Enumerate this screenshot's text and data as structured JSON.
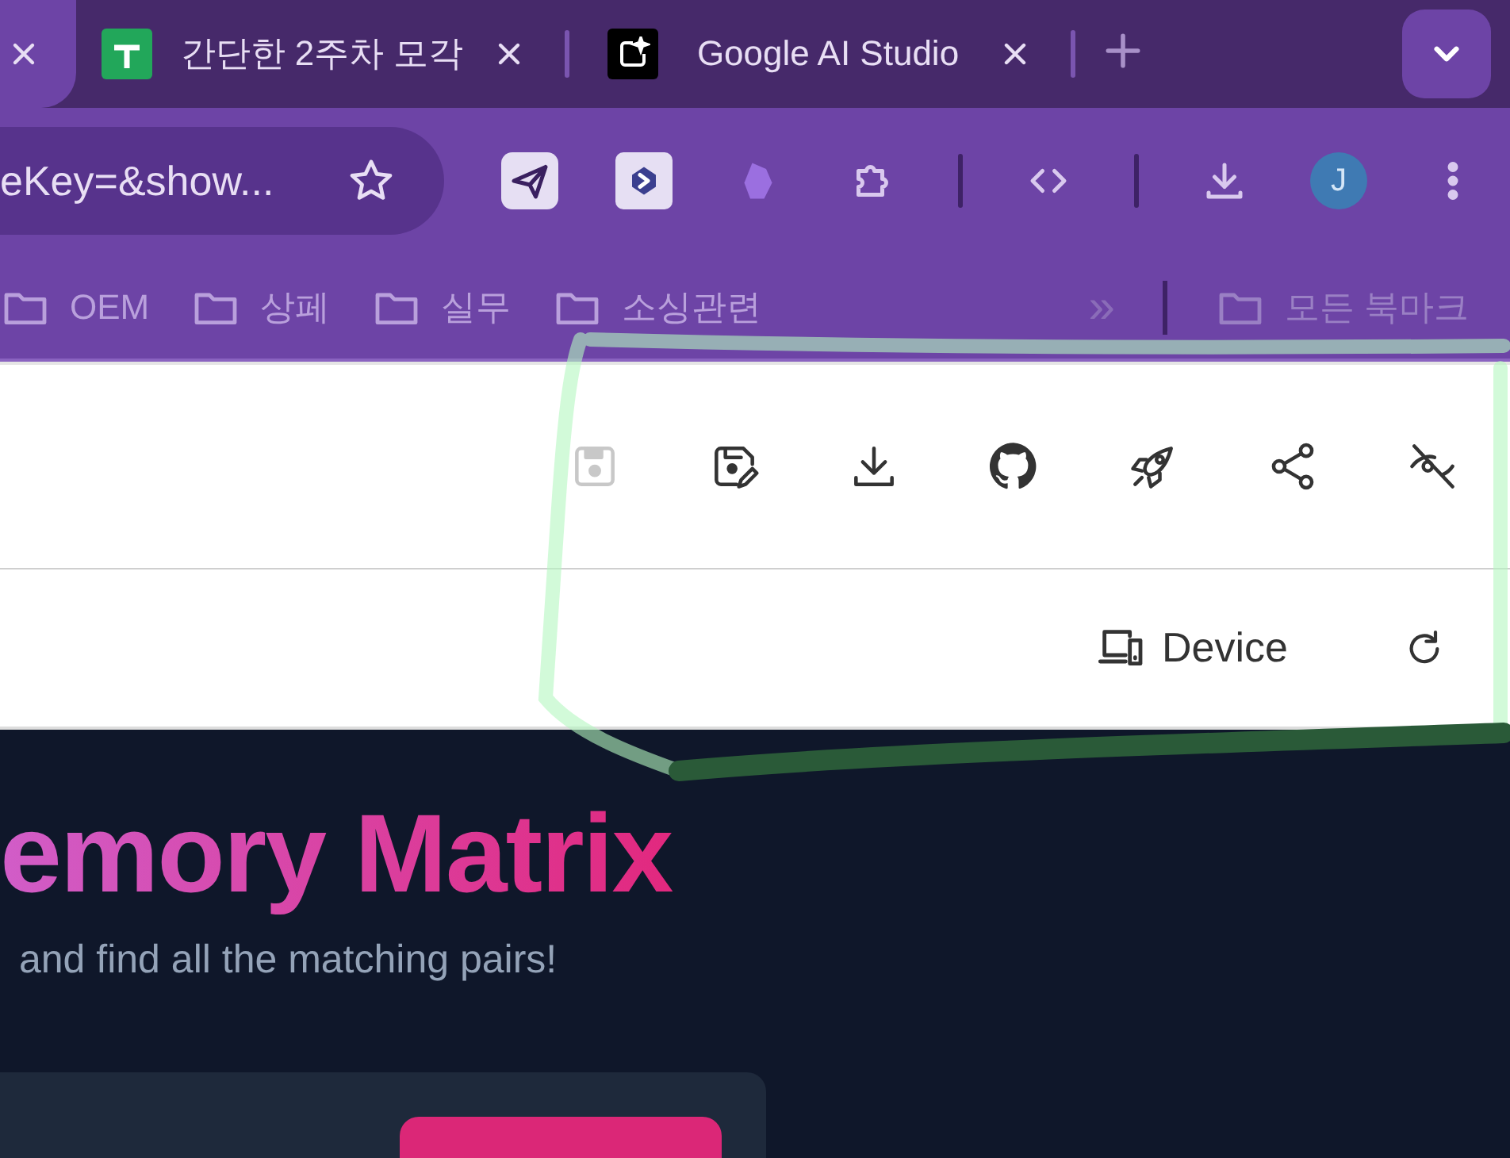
{
  "browser": {
    "tabs": [
      {
        "kind": "cut",
        "selected": true
      },
      {
        "kind": "sheet",
        "title": "간단한 2주차 모각",
        "selected": false
      },
      {
        "kind": "studio",
        "title": "Google AI Studio",
        "selected": false
      }
    ],
    "address": "eKey=&show...",
    "extensions": [
      {
        "kind": "plane"
      },
      {
        "kind": "graph"
      },
      {
        "kind": "gem"
      },
      {
        "kind": "puzzle"
      },
      {
        "kind": "divider"
      },
      {
        "kind": "code"
      },
      {
        "kind": "divider"
      },
      {
        "kind": "download"
      },
      {
        "kind": "avatar",
        "letter": "J"
      },
      {
        "kind": "menu"
      }
    ],
    "bookmarks": [
      {
        "label": "OEM"
      },
      {
        "label": "상페"
      },
      {
        "label": "실무"
      },
      {
        "label": "소싱관련"
      }
    ],
    "overflow": "»",
    "all_bookmarks": "모든 북마크"
  },
  "app_toolbar": {
    "actions": [
      {
        "kind": "save",
        "disabled": true
      },
      {
        "kind": "save-edit",
        "disabled": false
      },
      {
        "kind": "download",
        "disabled": false
      },
      {
        "kind": "github",
        "disabled": false
      },
      {
        "kind": "rocket",
        "disabled": false
      },
      {
        "kind": "share",
        "disabled": false
      },
      {
        "kind": "eye-off",
        "disabled": false
      }
    ],
    "device": "Device"
  },
  "page": {
    "title": "emory Matrix",
    "subtitle": "and find all the matching pairs!"
  }
}
